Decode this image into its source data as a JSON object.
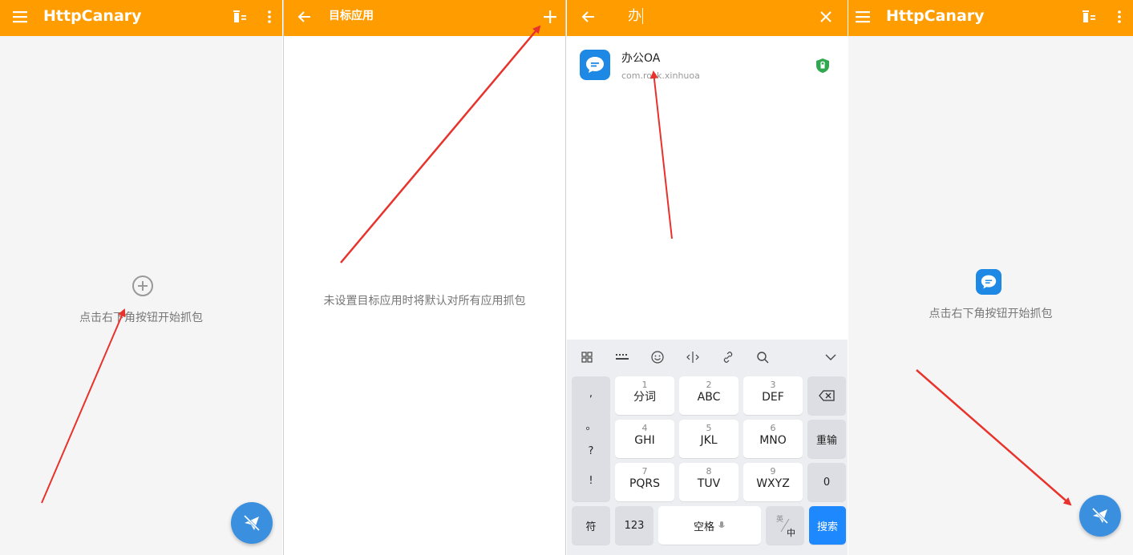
{
  "colors": {
    "appbar": "#ff9d00",
    "accent_blue": "#1e88e5",
    "arrow": "#e8322b"
  },
  "panel1": {
    "title": "HttpCanary",
    "empty_text": "点击右下角按钮开始抓包"
  },
  "panel2": {
    "title": "目标应用",
    "empty_text": "未设置目标应用时将默认对所有应用抓包"
  },
  "panel3": {
    "search_value": "办",
    "result": {
      "name": "办公OA",
      "package": "com.rock.xinhuoa"
    },
    "keyboard": {
      "punct": [
        ",",
        "。",
        "?",
        "!"
      ],
      "keys": [
        {
          "num": "1",
          "label": "分词"
        },
        {
          "num": "2",
          "label": "ABC"
        },
        {
          "num": "3",
          "label": "DEF"
        },
        {
          "num": "4",
          "label": "GHI"
        },
        {
          "num": "5",
          "label": "JKL"
        },
        {
          "num": "6",
          "label": "MNO"
        },
        {
          "num": "7",
          "label": "PQRS"
        },
        {
          "num": "8",
          "label": "TUV"
        },
        {
          "num": "9",
          "label": "WXYZ"
        }
      ],
      "reinput": "重输",
      "zero": "0",
      "symbol": "符",
      "numbers": "123",
      "space": "空格",
      "lang_top": "英",
      "lang_bottom": "中",
      "search": "搜索"
    }
  },
  "panel4": {
    "title": "HttpCanary",
    "empty_text": "点击右下角按钮开始抓包"
  }
}
